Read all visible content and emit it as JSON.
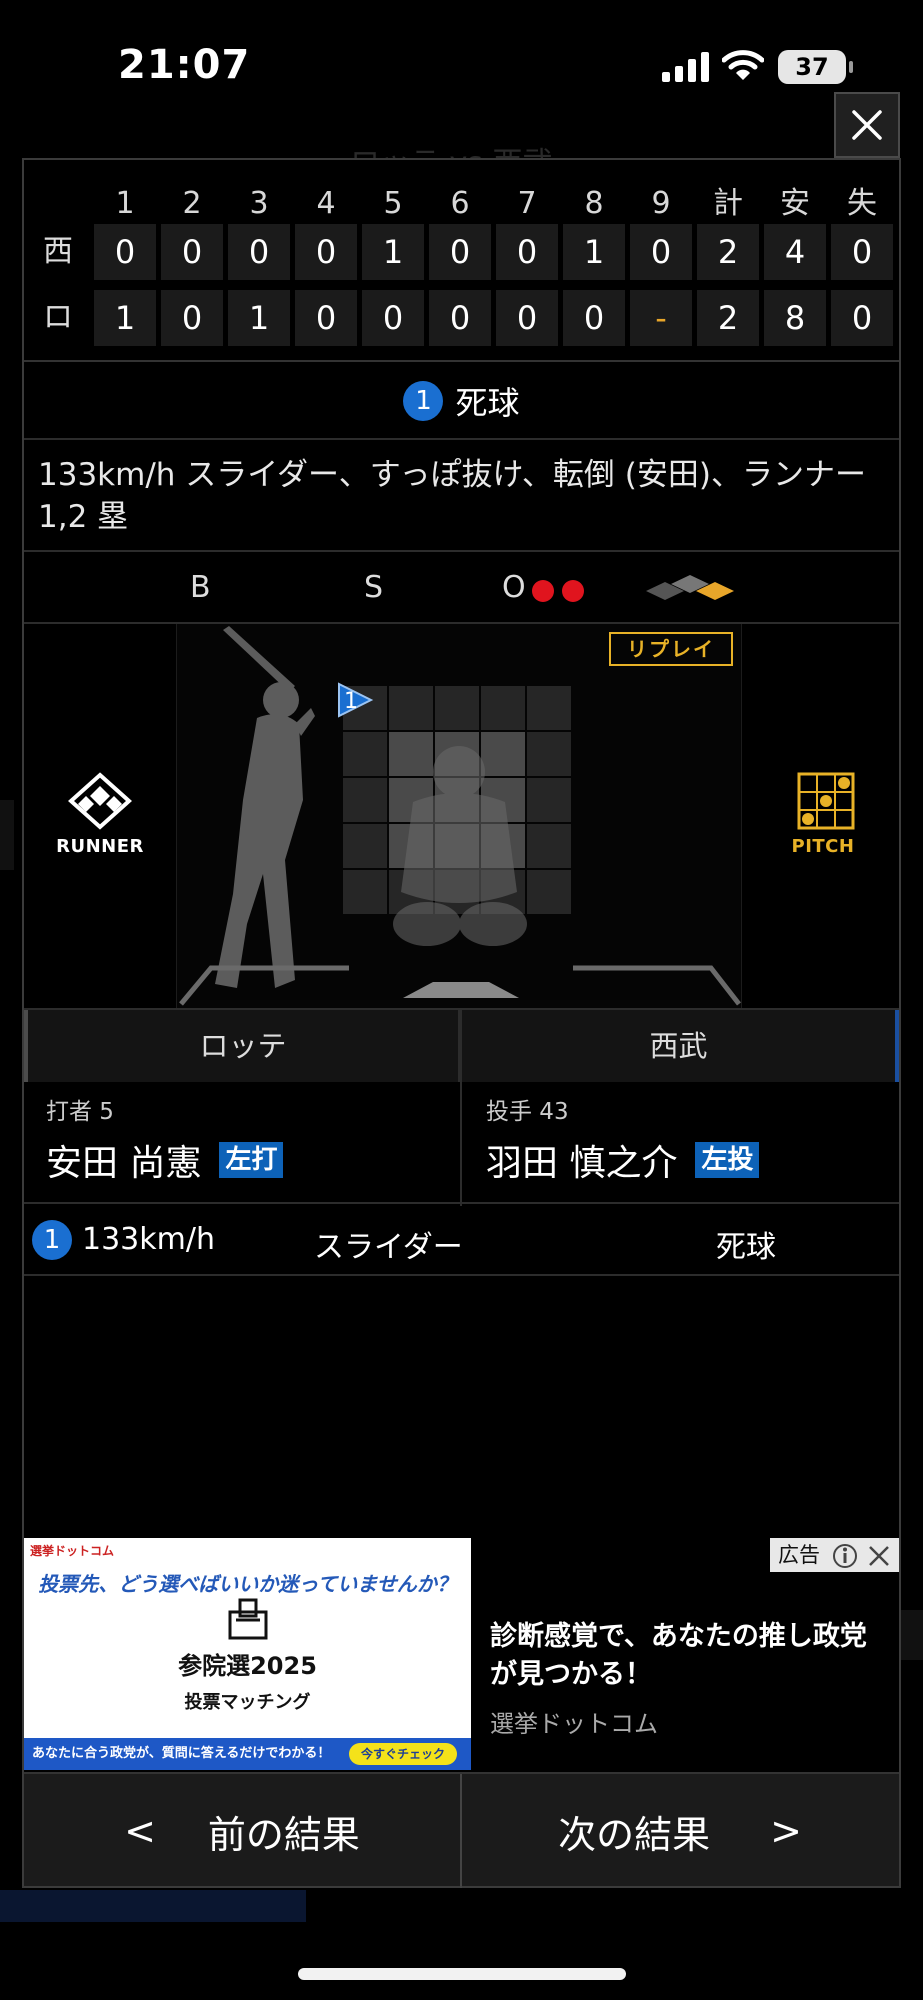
{
  "status_bar": {
    "time": "21:07",
    "battery": "37"
  },
  "background": {
    "title": "ロッテ vs 西武"
  },
  "scoreboard": {
    "innings": [
      "1",
      "2",
      "3",
      "4",
      "5",
      "6",
      "7",
      "8",
      "9",
      "計",
      "安",
      "失"
    ],
    "rows": [
      {
        "team": "西",
        "cells": [
          "0",
          "0",
          "0",
          "0",
          "1",
          "0",
          "0",
          "1",
          "0",
          "2",
          "4",
          "0"
        ]
      },
      {
        "team": "ロ",
        "cells": [
          "1",
          "0",
          "1",
          "0",
          "0",
          "0",
          "0",
          "0",
          "-",
          "2",
          "8",
          "0"
        ]
      }
    ]
  },
  "play": {
    "number": "1",
    "result": "死球",
    "description": "133km/h スライダー、すっぽ抜け、転倒 (安田)、ランナー1,2 塁"
  },
  "count": {
    "b_label": "B",
    "s_label": "S",
    "o_label": "O",
    "balls": 0,
    "strikes": 0,
    "outs": 2
  },
  "field": {
    "runner_label": "RUNNER",
    "pitch_label": "PITCH",
    "replay_label": "リプレイ",
    "pitch_marker": "1",
    "colors": {
      "accent": "#e8b227",
      "marker": "#1a6fd1"
    }
  },
  "teams": {
    "left_tab": "ロッテ",
    "right_tab": "西武",
    "batter": {
      "role": "打者 5",
      "name": "安田 尚憲",
      "hand": "左打"
    },
    "pitcher": {
      "role": "投手 43",
      "name": "羽田 慎之介",
      "hand": "左投"
    }
  },
  "pitches": [
    {
      "num": "1",
      "speed": "133km/h",
      "type": "スライダー",
      "result": "死球"
    }
  ],
  "ad": {
    "badge": "広告",
    "image_brand": "選挙ドットコム",
    "image_question": "投票先、どう選べばいいか迷っていませんか？",
    "image_election": "参院選2025",
    "image_matching": "投票マッチング",
    "image_bar": "あなたに合う政党が、質問に答えるだけでわかる！",
    "image_cta": "今すぐチェック",
    "headline": "診断感覚で、あなたの推し政党が見つかる！",
    "source": "選挙ドットコム"
  },
  "nav": {
    "prev_label": "前の結果",
    "next_label": "次の結果",
    "prev_arrow": "<",
    "next_arrow": ">"
  }
}
